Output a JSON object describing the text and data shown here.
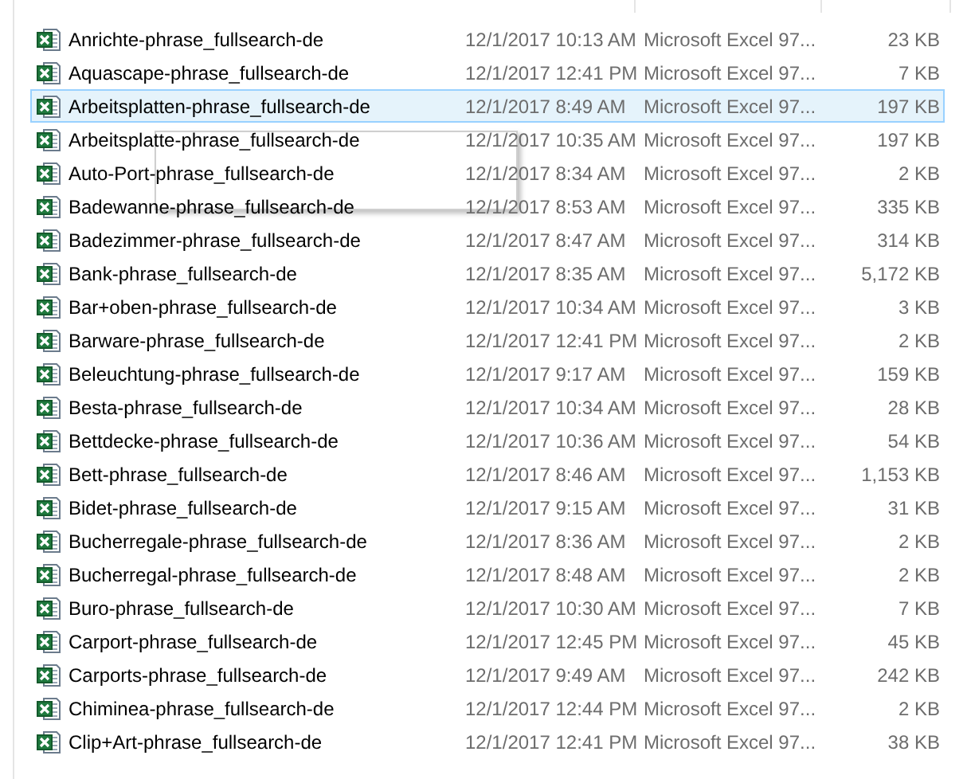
{
  "files": [
    {
      "name": "Anrichte-phrase_fullsearch-de",
      "date_modified": "12/1/2017 10:13 AM",
      "type": "Microsoft Excel 97...",
      "size": "23 KB",
      "selected": false
    },
    {
      "name": "Aquascape-phrase_fullsearch-de",
      "date_modified": "12/1/2017 12:41 PM",
      "type": "Microsoft Excel 97...",
      "size": "7 KB",
      "selected": false
    },
    {
      "name": "Arbeitsplatten-phrase_fullsearch-de",
      "date_modified": "12/1/2017 8:49 AM",
      "type": "Microsoft Excel 97...",
      "size": "197 KB",
      "selected": true
    },
    {
      "name": "Arbeitsplatte-phrase_fullsearch-de",
      "date_modified": "12/1/2017 10:35 AM",
      "type": "Microsoft Excel 97...",
      "size": "197 KB",
      "selected": false
    },
    {
      "name": "Auto-Port-phrase_fullsearch-de",
      "date_modified": "12/1/2017 8:34 AM",
      "type": "Microsoft Excel 97...",
      "size": "2 KB",
      "selected": false
    },
    {
      "name": "Badewanne-phrase_fullsearch-de",
      "date_modified": "12/1/2017 8:53 AM",
      "type": "Microsoft Excel 97...",
      "size": "335 KB",
      "selected": false
    },
    {
      "name": "Badezimmer-phrase_fullsearch-de",
      "date_modified": "12/1/2017 8:47 AM",
      "type": "Microsoft Excel 97...",
      "size": "314 KB",
      "selected": false
    },
    {
      "name": "Bank-phrase_fullsearch-de",
      "date_modified": "12/1/2017 8:35 AM",
      "type": "Microsoft Excel 97...",
      "size": "5,172 KB",
      "selected": false
    },
    {
      "name": "Bar+oben-phrase_fullsearch-de",
      "date_modified": "12/1/2017 10:34 AM",
      "type": "Microsoft Excel 97...",
      "size": "3 KB",
      "selected": false
    },
    {
      "name": "Barware-phrase_fullsearch-de",
      "date_modified": "12/1/2017 12:41 PM",
      "type": "Microsoft Excel 97...",
      "size": "2 KB",
      "selected": false
    },
    {
      "name": "Beleuchtung-phrase_fullsearch-de",
      "date_modified": "12/1/2017 9:17 AM",
      "type": "Microsoft Excel 97...",
      "size": "159 KB",
      "selected": false
    },
    {
      "name": "Besta-phrase_fullsearch-de",
      "date_modified": "12/1/2017 10:34 AM",
      "type": "Microsoft Excel 97...",
      "size": "28 KB",
      "selected": false
    },
    {
      "name": "Bettdecke-phrase_fullsearch-de",
      "date_modified": "12/1/2017 10:36 AM",
      "type": "Microsoft Excel 97...",
      "size": "54 KB",
      "selected": false
    },
    {
      "name": "Bett-phrase_fullsearch-de",
      "date_modified": "12/1/2017 8:46 AM",
      "type": "Microsoft Excel 97...",
      "size": "1,153 KB",
      "selected": false
    },
    {
      "name": "Bidet-phrase_fullsearch-de",
      "date_modified": "12/1/2017 9:15 AM",
      "type": "Microsoft Excel 97...",
      "size": "31 KB",
      "selected": false
    },
    {
      "name": "Bucherregale-phrase_fullsearch-de",
      "date_modified": "12/1/2017 8:36 AM",
      "type": "Microsoft Excel 97...",
      "size": "2 KB",
      "selected": false
    },
    {
      "name": "Bucherregal-phrase_fullsearch-de",
      "date_modified": "12/1/2017 8:48 AM",
      "type": "Microsoft Excel 97...",
      "size": "2 KB",
      "selected": false
    },
    {
      "name": "Buro-phrase_fullsearch-de",
      "date_modified": "12/1/2017 10:30 AM",
      "type": "Microsoft Excel 97...",
      "size": "7 KB",
      "selected": false
    },
    {
      "name": "Carport-phrase_fullsearch-de",
      "date_modified": "12/1/2017 12:45 PM",
      "type": "Microsoft Excel 97...",
      "size": "45 KB",
      "selected": false
    },
    {
      "name": "Carports-phrase_fullsearch-de",
      "date_modified": "12/1/2017 9:49 AM",
      "type": "Microsoft Excel 97...",
      "size": "242 KB",
      "selected": false
    },
    {
      "name": "Chiminea-phrase_fullsearch-de",
      "date_modified": "12/1/2017 12:44 PM",
      "type": "Microsoft Excel 97...",
      "size": "2 KB",
      "selected": false
    },
    {
      "name": "Clip+Art-phrase_fullsearch-de",
      "date_modified": "12/1/2017 12:41 PM",
      "type": "Microsoft Excel 97...",
      "size": "38 KB",
      "selected": false
    }
  ]
}
